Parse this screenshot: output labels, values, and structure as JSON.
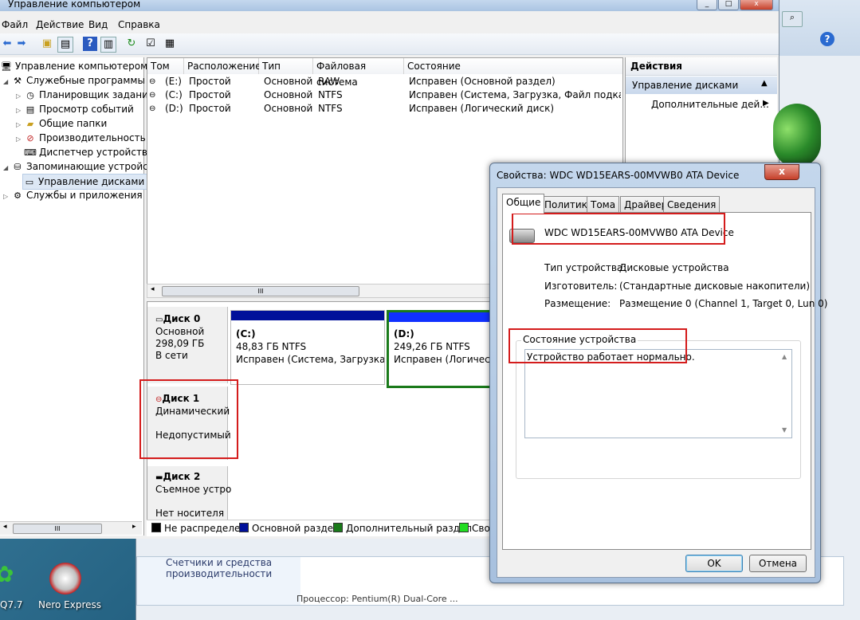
{
  "mmc": {
    "title": "Управление компьютером",
    "menu": [
      "Файл",
      "Действие",
      "Вид",
      "Справка"
    ],
    "tree": [
      {
        "label": "Управление компьютером (л",
        "icon": "computer-icon"
      },
      {
        "label": "Служебные программы",
        "icon": "tools-icon"
      },
      {
        "label": "Планировщик заданий",
        "icon": "clock-icon"
      },
      {
        "label": "Просмотр событий",
        "icon": "event-viewer-icon"
      },
      {
        "label": "Общие папки",
        "icon": "shared-folder-icon"
      },
      {
        "label": "Производительность",
        "icon": "performance-icon"
      },
      {
        "label": "Диспетчер устройств",
        "icon": "device-manager-icon"
      },
      {
        "label": "Запоминающие устройст",
        "icon": "storage-icon"
      },
      {
        "label": "Управление дисками",
        "icon": "disk-management-icon"
      },
      {
        "label": "Службы и приложения",
        "icon": "services-icon"
      }
    ],
    "volume_columns": [
      "Том",
      "Расположение",
      "Тип",
      "Файловая система",
      "Состояние"
    ],
    "volumes": [
      [
        "(E:)",
        "Простой",
        "Основной",
        "RAW",
        "Исправен (Основной раздел)"
      ],
      [
        "(C:)",
        "Простой",
        "Основной",
        "NTFS",
        "Исправен (Система, Загрузка, Файл подкачки, А"
      ],
      [
        "(D:)",
        "Простой",
        "Основной",
        "NTFS",
        "Исправен (Логический диск)"
      ]
    ],
    "hscroll_grip": "III",
    "disks": {
      "disk0": {
        "name": "Диск 0",
        "type": "Основной",
        "size": "298,09 ГБ",
        "status": "В сети"
      },
      "disk1": {
        "name": "Диск 1",
        "type": "Динамический",
        "status": "Недопустимый"
      },
      "disk2": {
        "name": "Диск 2",
        "type": "Съемное устро",
        "status": "Нет носителя"
      }
    },
    "partitions": {
      "c": {
        "label": "(C:)",
        "size": "48,83 ГБ NTFS",
        "status": "Исправен (Система, Загрузка, Ф"
      },
      "d": {
        "label": "(D:)",
        "size": "249,26 ГБ NTFS",
        "status": "Исправен (Логически"
      }
    },
    "legend": [
      {
        "label": "Не распределен",
        "color": "#000000"
      },
      {
        "label": "Основной раздел",
        "color": "#00109a"
      },
      {
        "label": "Дополнительный раздел",
        "color": "#1a7a1a"
      },
      {
        "label": "Сво",
        "color": "#22dd22"
      }
    ],
    "actions": {
      "header": "Действия",
      "section": "Управление дисками",
      "item": "Дополнительные дей..."
    }
  },
  "dialog": {
    "title": "Свойства: WDC WD15EARS-00MVWB0 ATA Device",
    "close": "x",
    "tabs": [
      "Общие",
      "Политика",
      "Тома",
      "Драйвер",
      "Сведения"
    ],
    "device_name": "WDC WD15EARS-00MVWB0 ATA Device",
    "fields": [
      {
        "label": "Тип устройства:",
        "value": "Дисковые устройства"
      },
      {
        "label": "Изготовитель:",
        "value": "(Стандартные дисковые накопители)"
      },
      {
        "label": "Размещение:",
        "value": "Размещение 0 (Channel 1, Target 0, Lun 0)"
      }
    ],
    "status_group": "Состояние устройства",
    "status_text": "Устройство работает нормально.",
    "ok": "OK",
    "cancel": "Отмена"
  },
  "background": {
    "text1": "Счетчики и средства",
    "text2": "производительности",
    "text3": "Процессор: Pentium(R) Dual-Core ..."
  },
  "desktop": {
    "icon1": "Q7.7",
    "icon2": "Nero Express"
  }
}
